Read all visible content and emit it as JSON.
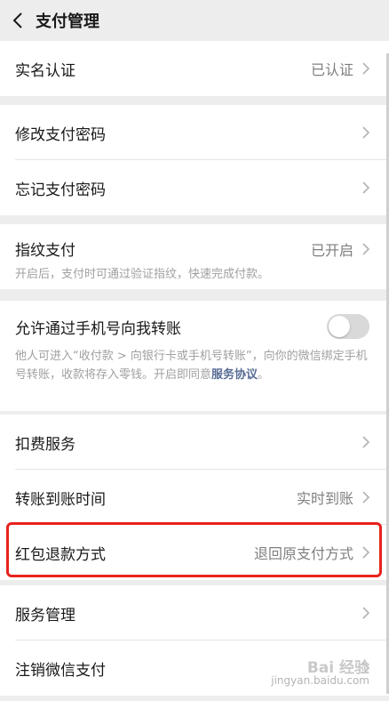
{
  "header": {
    "title": "支付管理",
    "back_icon": "chevron-left-icon"
  },
  "realname": {
    "label": "实名认证",
    "value": "已认证"
  },
  "password": {
    "change_label": "修改支付密码",
    "forgot_label": "忘记支付密码"
  },
  "fingerprint": {
    "label": "指纹支付",
    "value": "已开启",
    "desc": "开启后，支付时可通过验证指纹，快速完成付款。"
  },
  "phone_transfer": {
    "label": "允许通过手机号向我转账",
    "enabled": false,
    "desc_part1": "他人可进入“收付款 > 向银行卡或手机号转账”，向你的微信绑定手机号转账，收款将存入零钱。开启即同意",
    "desc_link": "服务协议",
    "desc_end": "。"
  },
  "services": {
    "deduction_label": "扣费服务",
    "transfer_time_label": "转账到账时间",
    "transfer_time_value": "实时到账",
    "redpacket_refund_label": "红包退款方式",
    "redpacket_refund_value": "退回原支付方式"
  },
  "management": {
    "service_manage_label": "服务管理",
    "cancel_pay_label": "注销微信支付"
  },
  "watermark": {
    "main": "Bai 经验",
    "sub": "jingyan.baidu.com"
  },
  "colors": {
    "background": "#ededed",
    "link": "#576b95",
    "highlight": "#e8221d"
  }
}
